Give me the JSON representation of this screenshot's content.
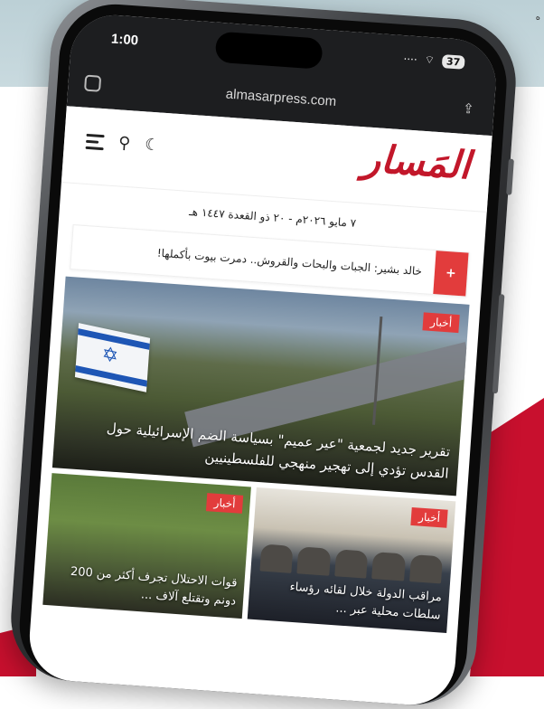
{
  "backdrop": {
    "corner_text": "ه",
    "accent_color": "#c8102e"
  },
  "status_bar": {
    "time": "1:00",
    "battery": "37"
  },
  "browser": {
    "url": "almasarpress.com",
    "left_icon": "reader-icon",
    "share_icon": "share-icon"
  },
  "site": {
    "logo": "المَسار",
    "icons": [
      "menu-icon",
      "search-icon",
      "moon-icon"
    ],
    "date": "٧ مايو ٢٠٢٦م - ٢٠ ذو القعدة ١٤٤٧ هـ",
    "ticker": {
      "badge": "+",
      "text": "خالد بشير: الجبات والبحات والقروش.. دمرت بيوت بأكملها!"
    },
    "lead_article": {
      "tag": "أخبار",
      "title": "تقرير جديد لجمعية \"عير عميم\" بسياسة الضم الإسرائيلية حول القدس تؤدي إلى تهجير منهجي للفلسطينيين"
    },
    "cards": [
      {
        "tag": "أخبار",
        "title": "قوات الاحتلال تجرف أكثر من 200 دونم وتقتلع آلاف ..."
      },
      {
        "tag": "أخبار",
        "title": "مراقب الدولة خلال لقائه رؤساء سلطات محلية عبر ..."
      }
    ]
  }
}
